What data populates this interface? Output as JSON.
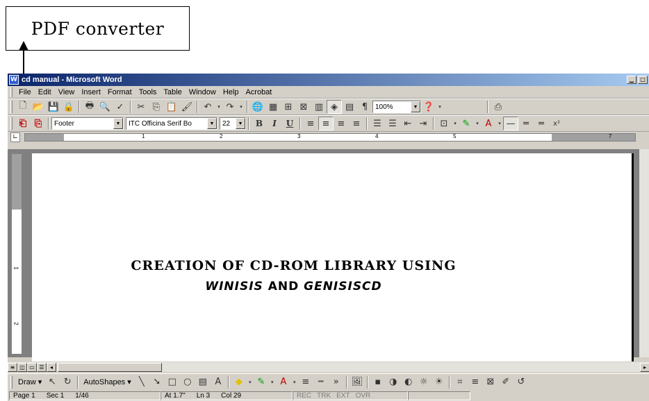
{
  "callout": {
    "label": "PDF converter"
  },
  "window": {
    "title": "cd manual - Microsoft Word",
    "controls": [
      "minimize",
      "maximize"
    ]
  },
  "menubar": {
    "items": [
      "File",
      "Edit",
      "View",
      "Insert",
      "Format",
      "Tools",
      "Table",
      "Window",
      "Help",
      "Acrobat"
    ]
  },
  "toolbar_standard": {
    "zoom": "100%"
  },
  "toolbar_formatting": {
    "style": "Footer",
    "font": "ITC Officina Serif Bo",
    "size": "22",
    "bold": "B",
    "italic": "I",
    "underline": "U"
  },
  "ruler": {
    "ticks": [
      "1",
      "2",
      "3",
      "4",
      "5",
      "7"
    ]
  },
  "vruler": {
    "ticks": [
      "1",
      "2"
    ]
  },
  "document": {
    "line1": "CREATION OF CD-ROM LIBRARY USING",
    "line2_part1": "WINISIS",
    "line2_part2": " AND ",
    "line2_part3": "GENISISCD"
  },
  "drawbar": {
    "draw": "Draw",
    "autoshapes": "AutoShapes"
  },
  "statusbar": {
    "page": "Page 1",
    "sec": "Sec 1",
    "pages": "1/46",
    "at": "At 1.7\"",
    "ln": "Ln 3",
    "col": "Col 29",
    "rec": "REC",
    "trk": "TRK",
    "ext": "EXT",
    "ovr": "OVR"
  }
}
